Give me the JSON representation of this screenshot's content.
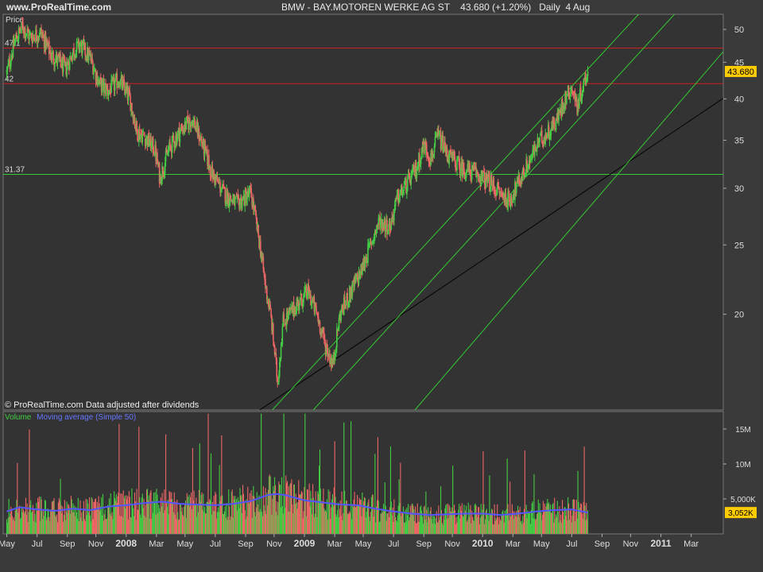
{
  "header": {
    "site": "www.ProRealTime.com",
    "title": "BMW - BAY.MOTOREN WERKE AG ST    43.680 (+1.20%)   Daily  4 Aug"
  },
  "price_panel": {
    "label": "Price",
    "footer": "© ProRealTime.com  Data adjusted after dividends",
    "last_price_badge": "43.680"
  },
  "volume_panel": {
    "label_volume": "Volume",
    "label_ma": "Moving average (Simple 50)",
    "last_volume_badge": "3,052K"
  },
  "colors": {
    "background": "#3a3a3a",
    "panel": "#333333",
    "up": "#44cc44",
    "down": "#ee6666",
    "hline_red": "#cc2222",
    "hline_green": "#33cc33",
    "trend_black": "#000000",
    "ma_line": "#5555ff",
    "badge": "#ffcc00"
  },
  "chart_data": [
    {
      "type": "line",
      "series": [
        {
          "values": [
            [
              2007.33,
              43.5
            ],
            [
              2007.38,
              48.5
            ],
            [
              2007.42,
              50.5
            ],
            [
              2007.46,
              48.8
            ],
            [
              2007.52,
              49.5
            ],
            [
              2007.58,
              46.0
            ],
            [
              2007.62,
              45.2
            ],
            [
              2007.66,
              44.0
            ],
            [
              2007.7,
              46.5
            ],
            [
              2007.74,
              47.6
            ],
            [
              2007.8,
              45.5
            ],
            [
              2007.85,
              42.0
            ],
            [
              2007.9,
              41.0
            ],
            [
              2007.96,
              42.5
            ],
            [
              2008.02,
              40.0
            ],
            [
              2008.06,
              36.0
            ],
            [
              2008.1,
              35.5
            ],
            [
              2008.16,
              34.0
            ],
            [
              2008.19,
              31.0
            ],
            [
              2008.24,
              34.0
            ],
            [
              2008.3,
              36.0
            ],
            [
              2008.37,
              37.5
            ],
            [
              2008.42,
              35.0
            ],
            [
              2008.48,
              31.5
            ],
            [
              2008.55,
              29.5
            ],
            [
              2008.62,
              28.5
            ],
            [
              2008.7,
              29.5
            ],
            [
              2008.75,
              25.0
            ],
            [
              2008.78,
              22.0
            ],
            [
              2008.81,
              20.0
            ],
            [
              2008.85,
              16.0
            ],
            [
              2008.88,
              19.5
            ],
            [
              2008.95,
              20.5
            ],
            [
              2009.02,
              21.5
            ],
            [
              2009.07,
              20.0
            ],
            [
              2009.12,
              18.0
            ],
            [
              2009.16,
              17.0
            ],
            [
              2009.2,
              20.0
            ],
            [
              2009.26,
              21.5
            ],
            [
              2009.32,
              23.0
            ],
            [
              2009.37,
              25.0
            ],
            [
              2009.42,
              27.0
            ],
            [
              2009.48,
              26.5
            ],
            [
              2009.52,
              29.0
            ],
            [
              2009.58,
              30.5
            ],
            [
              2009.63,
              32.0
            ],
            [
              2009.67,
              34.5
            ],
            [
              2009.71,
              33.0
            ],
            [
              2009.75,
              35.5
            ],
            [
              2009.8,
              33.5
            ],
            [
              2009.88,
              32.0
            ],
            [
              2009.96,
              31.5
            ],
            [
              2010.04,
              30.5
            ],
            [
              2010.1,
              29.5
            ],
            [
              2010.15,
              28.8
            ],
            [
              2010.2,
              30.5
            ],
            [
              2010.27,
              33.0
            ],
            [
              2010.32,
              35.0
            ],
            [
              2010.37,
              36.0
            ],
            [
              2010.42,
              37.5
            ],
            [
              2010.46,
              40.0
            ],
            [
              2010.5,
              41.5
            ],
            [
              2010.53,
              39.0
            ],
            [
              2010.56,
              41.5
            ],
            [
              2010.59,
              43.68
            ]
          ]
        }
      ],
      "y_ticks": [
        20,
        25,
        30,
        35,
        40,
        45,
        50
      ],
      "y_scale": "log",
      "ylim": [
        14.7,
        52.5
      ],
      "hlines": [
        {
          "value": 47.1,
          "label": "47.1",
          "color": "red"
        },
        {
          "value": 42,
          "label": "42",
          "color": "red"
        },
        {
          "value": 31.37,
          "label": "31.37",
          "color": "green"
        }
      ],
      "trendlines": [
        {
          "color": "black",
          "from": [
            2008.75,
            14.7
          ],
          "to": [
            2011.95,
            50.5
          ]
        },
        {
          "color": "green",
          "from": [
            2008.82,
            14.7
          ],
          "to": [
            2010.95,
            55.0
          ]
        },
        {
          "color": "green",
          "from": [
            2009.05,
            14.7
          ],
          "to": [
            2011.15,
            55.0
          ]
        },
        {
          "color": "green",
          "from": [
            2009.62,
            14.7
          ],
          "to": [
            2011.6,
            55.0
          ]
        }
      ]
    },
    {
      "type": "bar",
      "y_ticks": [
        "5,000K",
        "10M",
        "15M"
      ],
      "y_tick_values": [
        5000,
        10000,
        15000
      ],
      "ylim": [
        0,
        17500
      ],
      "series": [
        {
          "values": [
            [
              2007.33,
              3200
            ],
            [
              2007.4,
              3800
            ],
            [
              2007.5,
              3500
            ],
            [
              2007.6,
              3300
            ],
            [
              2007.7,
              3600
            ],
            [
              2007.8,
              3400
            ],
            [
              2007.9,
              3900
            ],
            [
              2008.0,
              4100
            ],
            [
              2008.1,
              4400
            ],
            [
              2008.2,
              4600
            ],
            [
              2008.3,
              4300
            ],
            [
              2008.4,
              4200
            ],
            [
              2008.5,
              4100
            ],
            [
              2008.6,
              4300
            ],
            [
              2008.7,
              4700
            ],
            [
              2008.8,
              5600
            ],
            [
              2008.85,
              5700
            ],
            [
              2008.9,
              5500
            ],
            [
              2009.0,
              4800
            ],
            [
              2009.1,
              4500
            ],
            [
              2009.2,
              4200
            ],
            [
              2009.3,
              4100
            ],
            [
              2009.4,
              3600
            ],
            [
              2009.5,
              3200
            ],
            [
              2009.6,
              2900
            ],
            [
              2009.7,
              2700
            ],
            [
              2009.8,
              2800
            ],
            [
              2009.9,
              2900
            ],
            [
              2010.0,
              2900
            ],
            [
              2010.1,
              2700
            ],
            [
              2010.2,
              2900
            ],
            [
              2010.3,
              3200
            ],
            [
              2010.4,
              3400
            ],
            [
              2010.5,
              3500
            ],
            [
              2010.59,
              3052
            ]
          ]
        }
      ]
    }
  ],
  "x_axis": {
    "ticks": [
      {
        "label": "May",
        "t": 2007.33
      },
      {
        "label": "Jul",
        "t": 2007.5
      },
      {
        "label": "Sep",
        "t": 2007.67
      },
      {
        "label": "Nov",
        "t": 2007.83
      },
      {
        "label": "2008",
        "t": 2008.0,
        "bold": true
      },
      {
        "label": "Mar",
        "t": 2008.17
      },
      {
        "label": "May",
        "t": 2008.33
      },
      {
        "label": "Jul",
        "t": 2008.5
      },
      {
        "label": "Sep",
        "t": 2008.67
      },
      {
        "label": "Nov",
        "t": 2008.83
      },
      {
        "label": "2009",
        "t": 2009.0,
        "bold": true
      },
      {
        "label": "Mar",
        "t": 2009.17
      },
      {
        "label": "May",
        "t": 2009.33
      },
      {
        "label": "Jul",
        "t": 2009.5
      },
      {
        "label": "Sep",
        "t": 2009.67
      },
      {
        "label": "Nov",
        "t": 2009.83
      },
      {
        "label": "2010",
        "t": 2010.0,
        "bold": true
      },
      {
        "label": "Mar",
        "t": 2010.17
      },
      {
        "label": "May",
        "t": 2010.33
      },
      {
        "label": "Jul",
        "t": 2010.5
      },
      {
        "label": "Sep",
        "t": 2010.67
      },
      {
        "label": "Nov",
        "t": 2010.83
      },
      {
        "label": "2011",
        "t": 2011.0,
        "bold": true
      },
      {
        "label": "Mar",
        "t": 2011.17
      }
    ]
  }
}
